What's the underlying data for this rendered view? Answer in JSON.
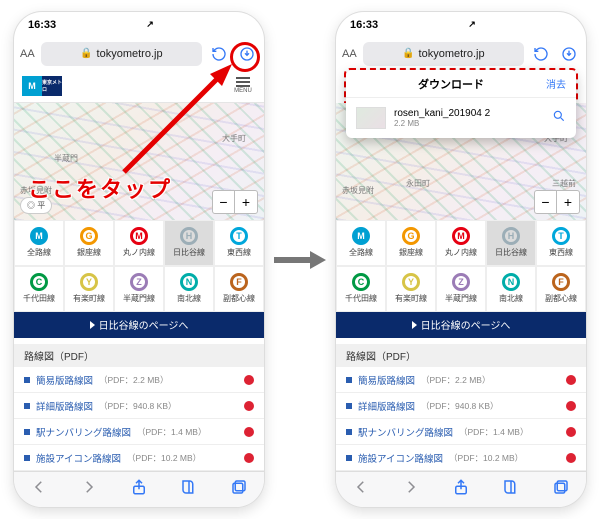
{
  "status": {
    "time": "16:33",
    "carrier_arrow": "↗"
  },
  "addr": {
    "aa": "AA",
    "lock": "🔒",
    "url": "tokyometro.jp"
  },
  "menu": {
    "label": "MENU"
  },
  "map": {
    "station_a": "大手町",
    "station_b": "半蔵門",
    "station_c": "赤坂見附",
    "station_d": "永田町",
    "station_e": "三越前",
    "zoom_minus": "−",
    "zoom_plus": "+",
    "chip": "◎ 平"
  },
  "lines": [
    {
      "letter": "M",
      "color": "#00a0d2",
      "label": "全路線",
      "sel": false,
      "fill": true
    },
    {
      "letter": "G",
      "color": "#f39700",
      "label": "銀座線",
      "sel": false
    },
    {
      "letter": "M",
      "color": "#e60012",
      "label": "丸ノ内線",
      "sel": false
    },
    {
      "letter": "H",
      "color": "#9caeb7",
      "label": "日比谷線",
      "sel": true
    },
    {
      "letter": "T",
      "color": "#00a7db",
      "label": "東西線",
      "sel": false
    },
    {
      "letter": "C",
      "color": "#009944",
      "label": "千代田線",
      "sel": false
    },
    {
      "letter": "Y",
      "color": "#d7c447",
      "label": "有楽町線",
      "sel": false
    },
    {
      "letter": "Z",
      "color": "#9b7cb6",
      "label": "半蔵門線",
      "sel": false
    },
    {
      "letter": "N",
      "color": "#00ada9",
      "label": "南北線",
      "sel": false
    },
    {
      "letter": "F",
      "color": "#bb641d",
      "label": "副都心線",
      "sel": false
    }
  ],
  "cta": "日比谷線のページへ",
  "section": "路線図（PDF）",
  "pdfs": [
    {
      "name": "簡易版路線図",
      "info": "（PDF：2.2 MB）"
    },
    {
      "name": "詳細版路線図",
      "info": "（PDF：940.8 KB）"
    },
    {
      "name": "駅ナンバリング路線図",
      "info": "（PDF：1.4 MB）"
    },
    {
      "name": "施設アイコン路線図",
      "info": "（PDF：10.2 MB）"
    }
  ],
  "download": {
    "title": "ダウンロード",
    "clear": "消去",
    "file": "rosen_kani_201904 2",
    "size": "2.2 MB"
  },
  "annot": {
    "callout": "ここをタップ"
  }
}
